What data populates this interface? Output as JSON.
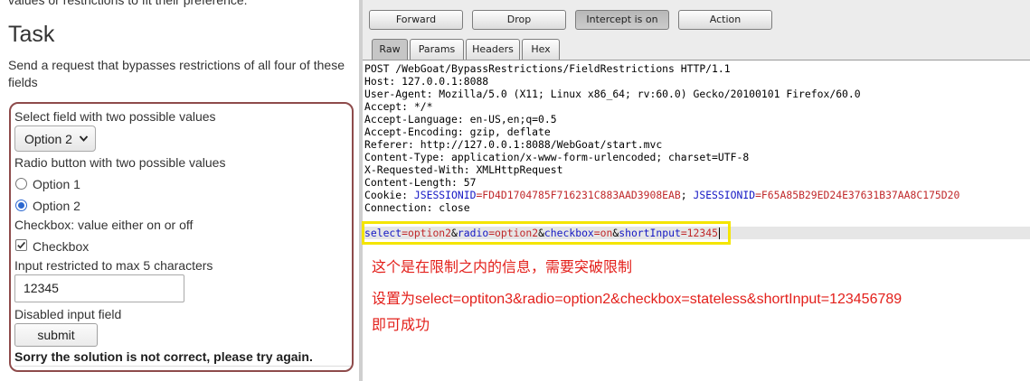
{
  "left_page": {
    "intro_tail": "values or restrictions to fit their preference.",
    "heading": "Task",
    "description": "Send a request that bypasses restrictions of all four of these fields",
    "form": {
      "select_label": "Select field with two possible values",
      "select_value": "Option 2",
      "radio_label": "Radio button with two possible values",
      "radio_options": [
        {
          "label": "Option 1",
          "checked": false
        },
        {
          "label": "Option 2",
          "checked": true
        }
      ],
      "checkbox_label": "Checkbox: value either on or off",
      "checkbox": {
        "label": "Checkbox",
        "checked": true
      },
      "short_input_label": "Input restricted to max 5 characters",
      "short_input_value": "12345",
      "disabled_label": "Disabled input field",
      "submit_label": "submit",
      "feedback": "Sorry the solution is not correct, please try again."
    }
  },
  "burp": {
    "buttons": [
      {
        "label": "Forward",
        "pressed": false
      },
      {
        "label": "Drop",
        "pressed": false
      },
      {
        "label": "Intercept is on",
        "pressed": true
      },
      {
        "label": "Action",
        "pressed": false
      }
    ],
    "tabs": [
      {
        "label": "Raw",
        "selected": true
      },
      {
        "label": "Params",
        "selected": false
      },
      {
        "label": "Headers",
        "selected": false
      },
      {
        "label": "Hex",
        "selected": false
      }
    ],
    "request": {
      "request_line": "POST /WebGoat/BypassRestrictions/FieldRestrictions HTTP/1.1",
      "headers": [
        {
          "name": "Host",
          "value": "127.0.0.1:8088"
        },
        {
          "name": "User-Agent",
          "value": "Mozilla/5.0 (X11; Linux x86_64; rv:60.0) Gecko/20100101 Firefox/60.0"
        },
        {
          "name": "Accept",
          "value": "*/*"
        },
        {
          "name": "Accept-Language",
          "value": "en-US,en;q=0.5"
        },
        {
          "name": "Accept-Encoding",
          "value": "gzip, deflate"
        },
        {
          "name": "Referer",
          "value": "http://127.0.0.1:8088/WebGoat/start.mvc"
        },
        {
          "name": "Content-Type",
          "value": "application/x-www-form-urlencoded; charset=UTF-8"
        },
        {
          "name": "X-Requested-With",
          "value": "XMLHttpRequest"
        },
        {
          "name": "Content-Length",
          "value": "57"
        },
        {
          "name": "Cookie",
          "cookies": [
            {
              "name": "JSESSIONID",
              "value": "FD4D1704785F716231C883AAD3908EAB"
            },
            {
              "name": "JSESSIONID",
              "value": "F65A85B29ED24E37631B37AA8C175D20"
            }
          ]
        },
        {
          "name": "Connection",
          "value": "close"
        }
      ],
      "body_params": [
        {
          "name": "select",
          "value": "option2"
        },
        {
          "name": "radio",
          "value": "option2"
        },
        {
          "name": "checkbox",
          "value": "on"
        },
        {
          "name": "shortInput",
          "value": "12345"
        }
      ]
    }
  },
  "annotations": [
    "这个是在限制之内的信息，需要突破限制",
    "设置为select=optiton3&radio=option2&checkbox=stateless&shortInput=123456789",
    "即可成功"
  ],
  "colors": {
    "param_name": "#1417c4",
    "param_value": "#c0282a",
    "annotation": "#e3201b",
    "highlight_border": "#f4e500",
    "form_border": "#8e4b4b",
    "radio_accent": "#2b67d0"
  },
  "icons": {
    "select_chevron": "chevron-down-icon",
    "checkbox_mark": "checkmark-icon"
  }
}
